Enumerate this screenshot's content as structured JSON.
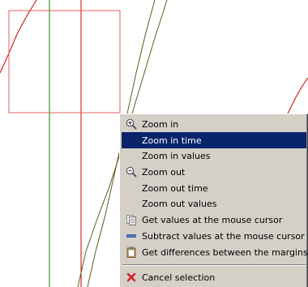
{
  "context_menu": {
    "items": [
      {
        "label": "Zoom in",
        "icon": "zoom-in-icon",
        "highlighted": false
      },
      {
        "label": "Zoom in time",
        "icon": "",
        "highlighted": true
      },
      {
        "label": "Zoom in values",
        "icon": "",
        "highlighted": false
      },
      {
        "label": "Zoom out",
        "icon": "zoom-out-icon",
        "highlighted": false
      },
      {
        "label": "Zoom out time",
        "icon": "",
        "highlighted": false
      },
      {
        "label": "Zoom out values",
        "icon": "",
        "highlighted": false
      },
      {
        "label": "Get values at the mouse cursor",
        "icon": "copy-values-icon",
        "highlighted": false
      },
      {
        "label": "Subtract values at the mouse cursor",
        "icon": "minus-icon",
        "highlighted": false
      },
      {
        "label": "Get differences between the margins",
        "icon": "clipboard-icon",
        "highlighted": false
      },
      {
        "label": "Cancel selection",
        "icon": "cancel-icon",
        "highlighted": false
      }
    ],
    "highlight_color": "#0a246a",
    "background_color": "#d4d0c8"
  },
  "plot": {
    "selection_color": "#e05050",
    "cursor_line_color": "#008000",
    "marker_line_color": "#cc0000",
    "trace_color_1": "#cc0000",
    "trace_color_2": "#5a5a1e"
  }
}
